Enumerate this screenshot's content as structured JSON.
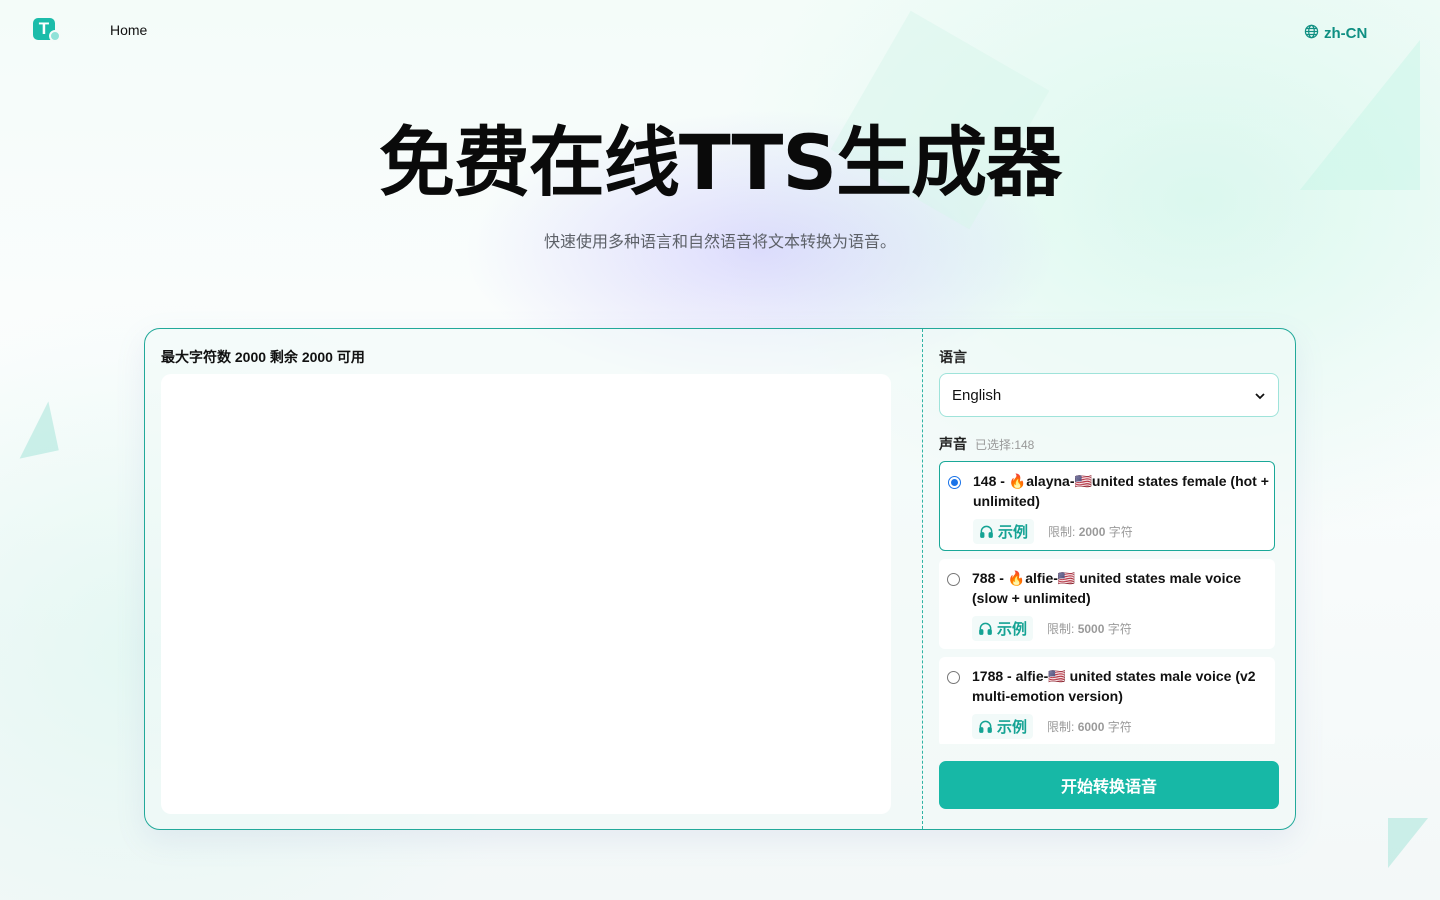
{
  "header": {
    "logo_letter": "T",
    "nav_home": "Home",
    "language_switch": "zh-CN"
  },
  "hero": {
    "title": "免费在线TTS生成器",
    "subtitle": "快速使用多种语言和自然语音将文本转换为语音。"
  },
  "editor": {
    "char_info": "最大字符数 2000 剩余 2000 可用",
    "text_value": ""
  },
  "settings": {
    "language_label": "语言",
    "language_selected": "English",
    "voice_label": "声音",
    "voice_selected_text": "已选择:148",
    "voices": [
      {
        "name": "148 - 🔥alayna-🇺🇸united states female (hot + unlimited)",
        "sample": "示例",
        "limit_prefix": "限制:",
        "limit_value": "2000",
        "limit_unit": "字符",
        "selected": true
      },
      {
        "name": "788 - 🔥alfie-🇺🇸 united states male voice (slow + unlimited)",
        "sample": "示例",
        "limit_prefix": "限制:",
        "limit_value": "5000",
        "limit_unit": "字符",
        "selected": false
      },
      {
        "name": "1788 - alfie-🇺🇸 united states male voice (v2 multi-emotion version)",
        "sample": "示例",
        "limit_prefix": "限制:",
        "limit_value": "6000",
        "limit_unit": "字符",
        "selected": false
      }
    ],
    "convert_button": "开始转换语音"
  },
  "colors": {
    "accent": "#17b8a6",
    "accent_text": "#0f8f82",
    "radio_selected": "#1a73e8"
  }
}
